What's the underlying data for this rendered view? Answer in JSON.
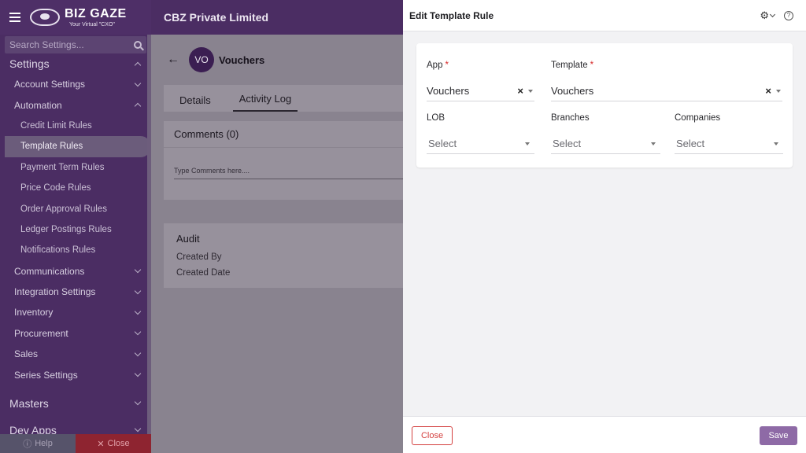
{
  "topbar": {
    "company": "CBZ Private Limited"
  },
  "logo": {
    "name": "BIZ GAZE",
    "tagline": "Your Virtual \"CXO\""
  },
  "sidebar": {
    "search_placeholder": "Search Settings...",
    "settings_label": "Settings",
    "items": [
      {
        "label": "Account Settings"
      },
      {
        "label": "Automation"
      }
    ],
    "automation_sub": [
      {
        "label": "Credit Limit Rules"
      },
      {
        "label": "Template Rules"
      },
      {
        "label": "Payment Term Rules"
      },
      {
        "label": "Price Code Rules"
      },
      {
        "label": "Order Approval Rules"
      },
      {
        "label": "Ledger Postings Rules"
      },
      {
        "label": "Notifications Rules"
      }
    ],
    "more_items": [
      {
        "label": "Communications"
      },
      {
        "label": "Integration Settings"
      },
      {
        "label": "Inventory"
      },
      {
        "label": "Procurement"
      },
      {
        "label": "Sales"
      },
      {
        "label": "Series Settings"
      }
    ],
    "masters_label": "Masters",
    "devapps_label": "Dev Apps",
    "footer": {
      "help": "Help",
      "close": "Close"
    }
  },
  "record": {
    "avatar": "VO",
    "title": "Vouchers",
    "tabs": [
      {
        "label": "Details"
      },
      {
        "label": "Activity Log"
      }
    ],
    "comments_title": "Comments (0)",
    "comments_placeholder": "Type Comments here....",
    "audit": {
      "title": "Audit",
      "created_by": "Created By",
      "created_date": "Created Date"
    }
  },
  "drawer": {
    "title": "Edit Template Rule",
    "fields": {
      "app": {
        "label": "App",
        "value": "Vouchers"
      },
      "template": {
        "label": "Template",
        "value": "Vouchers"
      },
      "lob": {
        "label": "LOB",
        "placeholder": "Select"
      },
      "branches": {
        "label": "Branches",
        "placeholder": "Select"
      },
      "companies": {
        "label": "Companies",
        "placeholder": "Select"
      }
    },
    "close_label": "Close",
    "save_label": "Save"
  }
}
